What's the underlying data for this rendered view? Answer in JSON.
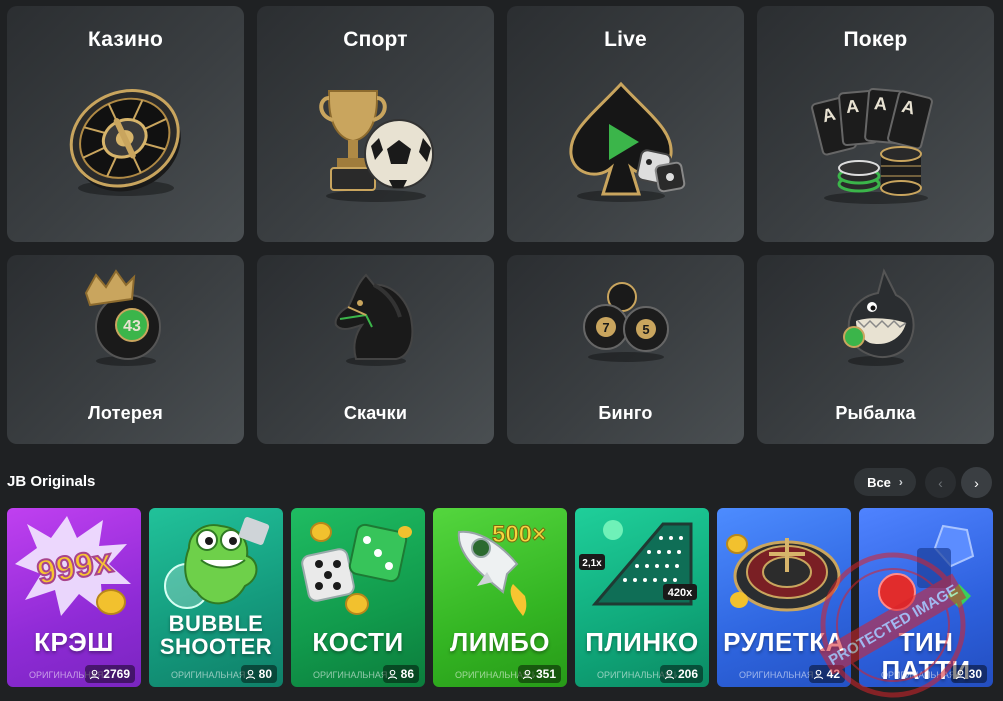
{
  "categories": [
    {
      "label": "Казино",
      "icon": "roulette-wheel-icon"
    },
    {
      "label": "Спорт",
      "icon": "trophy-football-icon"
    },
    {
      "label": "Live",
      "icon": "spade-play-icon"
    },
    {
      "label": "Покер",
      "icon": "playing-cards-chips-icon"
    },
    {
      "label": "Лотерея",
      "icon": "lottery-ball-crown-icon",
      "ball_number": "43"
    },
    {
      "label": "Скачки",
      "icon": "horse-head-icon"
    },
    {
      "label": "Бинго",
      "icon": "bingo-balls-icon",
      "ball_numbers": [
        "7",
        "5"
      ]
    },
    {
      "label": "Рыбалка",
      "icon": "shark-icon"
    }
  ],
  "originals": {
    "title": "JB Originals",
    "all_label": "Все",
    "prev_icon": "chevron-left-icon",
    "next_icon": "chevron-right-icon",
    "games": [
      {
        "title": "КРЭШ",
        "subtitle": "ОРИГИНАЛЬНАЯ ИГРА",
        "players": "2769",
        "art_text": "999x"
      },
      {
        "title": "BUBBLE SHOOTER",
        "title_line1": "BUBBLE",
        "title_line2": "SHOOTER",
        "subtitle": "ОРИГИНАЛЬНАЯ ИГРА",
        "players": "80"
      },
      {
        "title": "КОСТИ",
        "subtitle": "ОРИГИНАЛЬНАЯ ИГРА",
        "players": "86"
      },
      {
        "title": "ЛИМБО",
        "subtitle": "ОРИГИНАЛЬНАЯ ИГРА",
        "players": "351",
        "art_text": "500×"
      },
      {
        "title": "ПЛИНКО",
        "subtitle": "ОРИГИНАЛЬНАЯ ИГРА",
        "players": "206",
        "art_text_1": "2,1x",
        "art_text_2": "420x"
      },
      {
        "title": "РУЛЕТКА",
        "subtitle": "ОРИГИНАЛЬНАЯ ИГРА",
        "players": "42"
      },
      {
        "title": "ТИН ПАТТИ",
        "subtitle": "ОРИГИНАЛЬНАЯ ИГРА",
        "players": "30"
      }
    ]
  },
  "watermark": {
    "text": "PROTECTED IMAGE"
  },
  "colors": {
    "background": "#1f2123",
    "tile": "#3b3f42",
    "accent_gold": "#d7b46a"
  }
}
